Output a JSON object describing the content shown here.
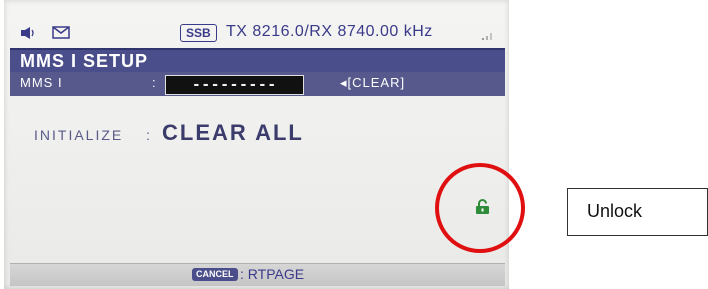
{
  "status_bar": {
    "speaker_icon": "speaker-icon",
    "mail_icon": "mail-icon",
    "mode": "SSB",
    "frequency": "TX 8216.0/RX 8740.00 kHz",
    "signal_icon": "signal-icon"
  },
  "title": "MMS I  SETUP",
  "mmsi_row": {
    "label": "MMS I",
    "colon": ":",
    "value": "---------",
    "clear": "◂[CLEAR]"
  },
  "initialize": {
    "label": "INITIALIZE",
    "colon": ":",
    "value": "CLEAR ALL"
  },
  "lock_icon": "unlock-icon",
  "bottom_bar": {
    "key": "CANCEL",
    "action": ": RTPAGE"
  },
  "annotation": {
    "label": "Unlock",
    "circle_color": "#e01010"
  }
}
